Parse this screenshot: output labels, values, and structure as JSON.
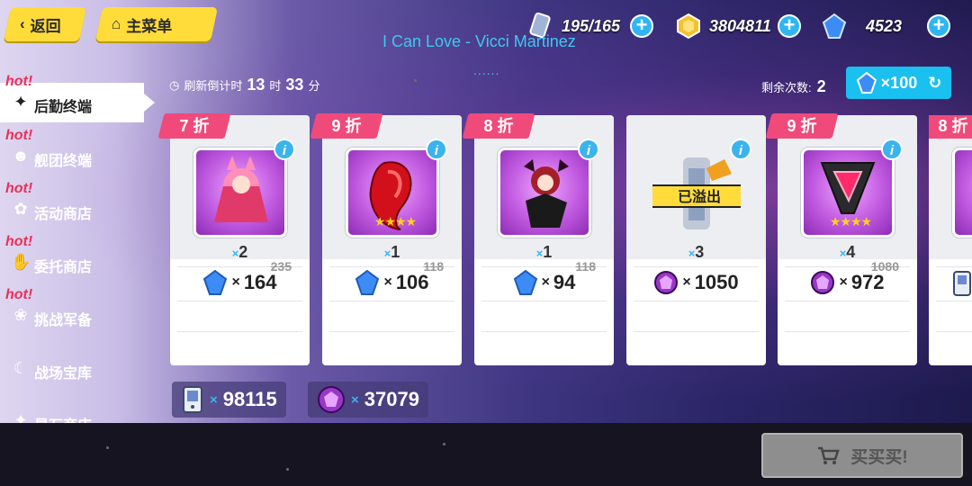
{
  "nav": {
    "back_label": "返回",
    "main_menu_label": "主菜单"
  },
  "resources": {
    "stamina": "195/165",
    "coins": "3804811",
    "crystals": "4523"
  },
  "now_playing": {
    "song": "I Can Love - Vicci Martinez",
    "dots": "......"
  },
  "sidebar": {
    "hot_tag": "hot!",
    "items": [
      {
        "label": "后勤终端",
        "hot": true,
        "active": true
      },
      {
        "label": "舰团终端",
        "hot": true
      },
      {
        "label": "活动商店",
        "hot": true
      },
      {
        "label": "委托商店",
        "hot": true
      },
      {
        "label": "挑战军备",
        "hot": true
      },
      {
        "label": "战场宝库",
        "hot": false
      },
      {
        "label": "星石商店",
        "hot": false
      }
    ]
  },
  "refresh": {
    "label": "刷新倒计时",
    "hours": "13",
    "hours_unit": "时",
    "minutes": "33",
    "minutes_unit": "分"
  },
  "remaining": {
    "label": "剩余次数:",
    "value": "2"
  },
  "reset": {
    "cost": "×100"
  },
  "cards": [
    {
      "discount": "7 折",
      "qty": "2",
      "old_price": "235",
      "price": "164",
      "currency": "crystal",
      "stars": ""
    },
    {
      "discount": "9 折",
      "qty": "1",
      "old_price": "118",
      "price": "106",
      "currency": "crystal",
      "stars": "★★★★"
    },
    {
      "discount": "8 折",
      "qty": "1",
      "old_price": "118",
      "price": "94",
      "currency": "crystal",
      "stars": ""
    },
    {
      "discount": "",
      "qty": "3",
      "old_price": "",
      "price": "1050",
      "currency": "orb",
      "stars": "",
      "overflow": "已溢出"
    },
    {
      "discount": "9 折",
      "qty": "4",
      "old_price": "1080",
      "price": "972",
      "currency": "orb",
      "stars": "★★★★"
    },
    {
      "discount": "8 折",
      "qty": "",
      "old_price": "",
      "price": "",
      "currency": "tablet",
      "stars": ""
    }
  ],
  "wallet": {
    "tablets": "98115",
    "orbs": "37079",
    "x": "×"
  },
  "buy": {
    "label": "买买买!"
  },
  "colors": {
    "accent": "#19c0f0",
    "hot": "#e8315a",
    "discount": "#f04a7a",
    "nav_button": "#ffdc3a"
  }
}
